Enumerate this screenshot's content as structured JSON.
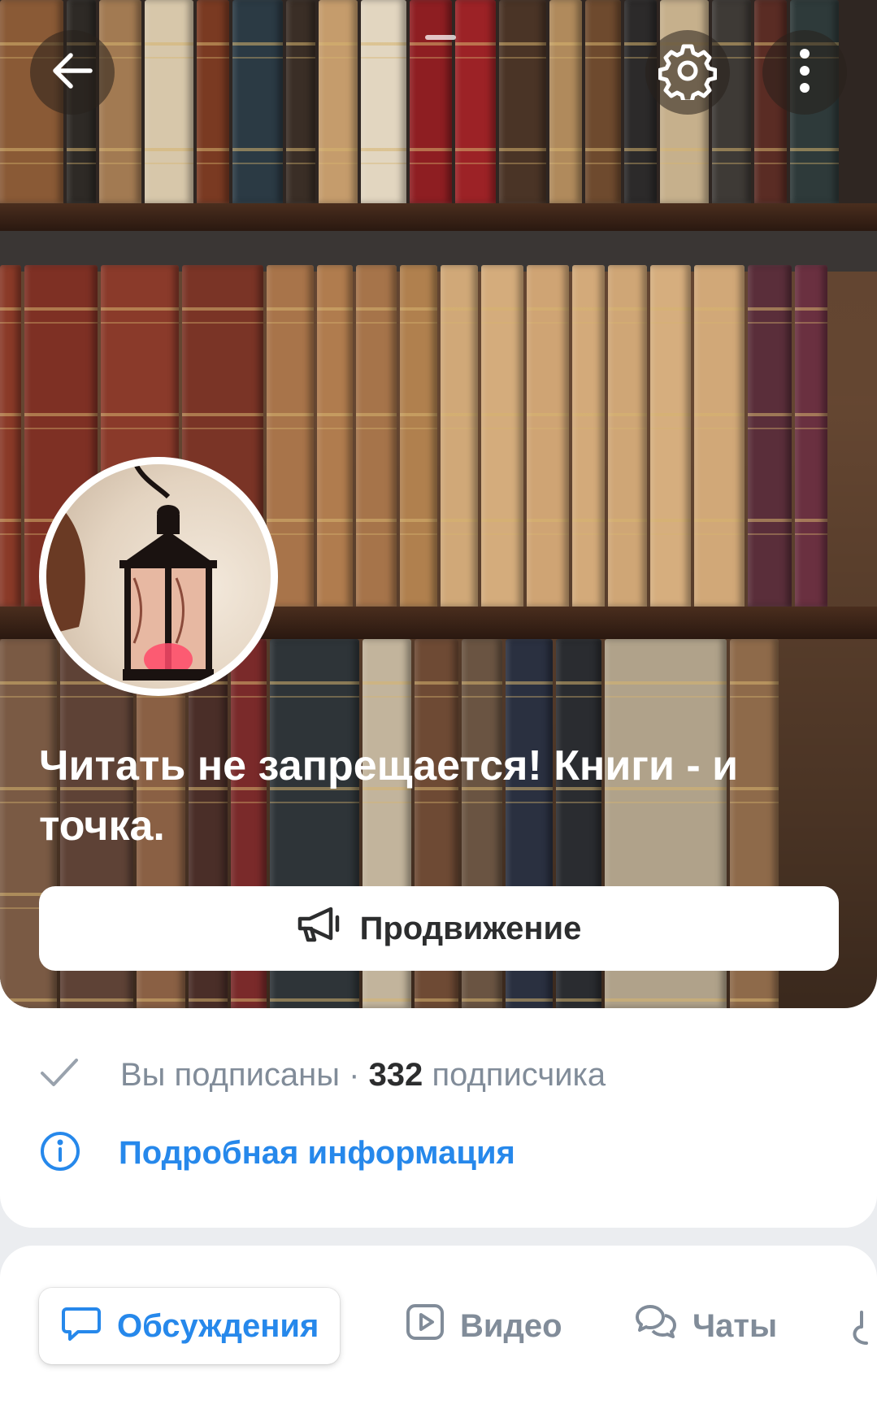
{
  "header": {
    "back_icon": "arrow-left-icon",
    "settings_icon": "gear-icon",
    "more_icon": "more-vertical-icon"
  },
  "group": {
    "title": "Читать не запрещается! Книги - и точка.",
    "promo_label": "Продвижение"
  },
  "info": {
    "subscribed_text": "Вы подписаны ·",
    "subscriber_count": "332",
    "subscriber_word": "подписчика",
    "details_label": "Подробная информация"
  },
  "tabs": [
    {
      "label": "Обсуждения",
      "icon": "message-icon",
      "active": true
    },
    {
      "label": "Видео",
      "icon": "video-play-icon",
      "active": false
    },
    {
      "label": "Чаты",
      "icon": "chats-icon",
      "active": false
    }
  ],
  "colors": {
    "accent": "#2688eb",
    "secondary_text": "#818c99",
    "primary_text": "#2c2d2e",
    "background": "#ebedf0"
  }
}
